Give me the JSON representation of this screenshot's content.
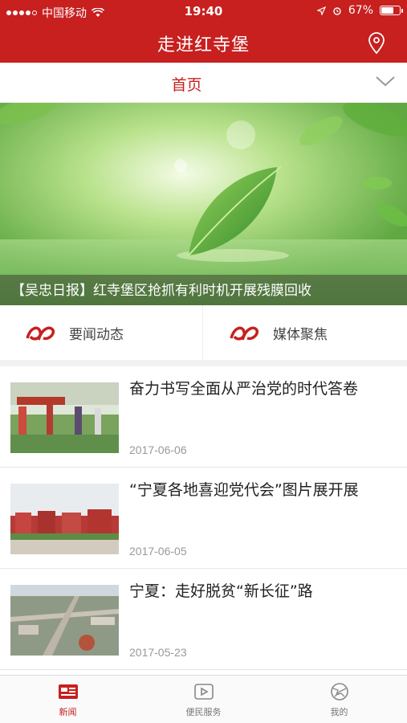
{
  "status_bar": {
    "carrier": "中国移动",
    "time": "19:40",
    "battery": "67%",
    "battery_level": 0.67,
    "signal_bars": 4
  },
  "header": {
    "title": "走进红寺堡",
    "location_icon": "location-pin-icon"
  },
  "channel": {
    "title": "首页",
    "dropdown_icon": "chevron-down-icon"
  },
  "banner": {
    "caption": "【吴忠日报】红寺堡区抢抓有利时机开展残膜回收"
  },
  "categories": [
    {
      "label": "要闻动态",
      "icon": "news-category-icon"
    },
    {
      "label": "媒体聚焦",
      "icon": "media-category-icon"
    }
  ],
  "news": [
    {
      "title": "奋力书写全面从严治党的时代答卷",
      "date": "2017-06-06"
    },
    {
      "title": "“宁夏各地喜迎党代会”图片展开展",
      "date": "2017-06-05"
    },
    {
      "title": "宁夏：走好脱贫“新长征”路",
      "date": "2017-05-23"
    }
  ],
  "tabs": [
    {
      "label": "新闻",
      "icon": "newspaper-icon",
      "active": true
    },
    {
      "label": "便民服务",
      "icon": "play-icon",
      "active": false
    },
    {
      "label": "我的",
      "icon": "globe-icon",
      "active": false
    }
  ],
  "colors": {
    "brand_red": "#c7201f",
    "text_dark": "#222222",
    "date_gray": "#999999"
  }
}
